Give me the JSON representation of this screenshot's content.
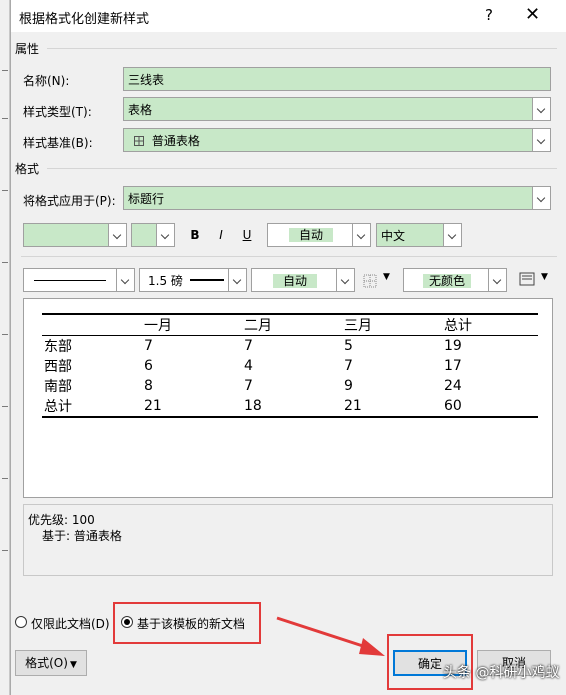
{
  "window": {
    "title": "根据格式化创建新样式",
    "help": "?",
    "close": "✕"
  },
  "properties": {
    "section": "属性",
    "name_label": "名称(N):",
    "name_value": "三线表",
    "type_label": "样式类型(T):",
    "type_value": "表格",
    "base_label": "样式基准(B):",
    "base_icon": "table-icon",
    "base_value": "普通表格"
  },
  "format": {
    "section": "格式",
    "apply_label": "将格式应用于(P):",
    "apply_value": "标题行",
    "font_name": "",
    "font_size": "",
    "bold": "B",
    "italic": "I",
    "underline": "U",
    "font_color": "自动",
    "script": "中文",
    "line_width": "1.5 磅",
    "line_color": "自动",
    "shading": "无颜色"
  },
  "preview": {
    "headers": [
      "",
      "一月",
      "二月",
      "三月",
      "总计"
    ],
    "rows": [
      [
        "东部",
        "7",
        "7",
        "5",
        "19"
      ],
      [
        "西部",
        "6",
        "4",
        "7",
        "17"
      ],
      [
        "南部",
        "8",
        "7",
        "9",
        "24"
      ],
      [
        "总计",
        "21",
        "18",
        "21",
        "60"
      ]
    ]
  },
  "description": {
    "priority": "优先级: 100",
    "based_on": "基于: 普通表格"
  },
  "options": {
    "only_this_doc": "仅限此文档(D)",
    "new_docs": "基于该模板的新文档"
  },
  "buttons": {
    "format": "格式(O)",
    "ok": "确定",
    "cancel": "取消"
  },
  "watermark": "头条 @科研小鸡蚁",
  "colors": {
    "field_bg": "#c8e8c8",
    "highlight": "#e23a3a"
  }
}
